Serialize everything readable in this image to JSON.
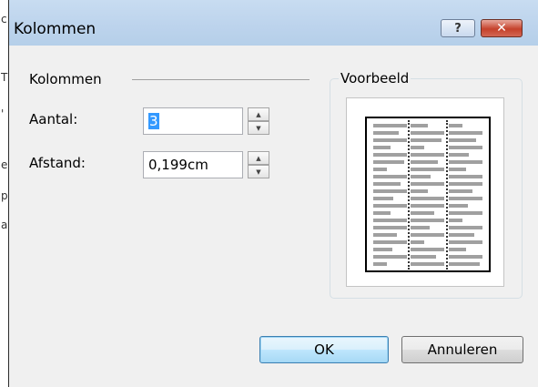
{
  "background_doc": {
    "fragments": [
      "c",
      "T",
      "'",
      "e",
      "p",
      "a"
    ]
  },
  "dialog": {
    "title": "Kolommen",
    "help_glyph": "?",
    "close_glyph": "✕",
    "section_label": "Kolommen",
    "count": {
      "label": "Aantal:",
      "value": "3"
    },
    "spacing": {
      "label": "Afstand:",
      "value": "0,199cm"
    },
    "preview": {
      "title": "Voorbeeld",
      "columns": 3
    },
    "ok_label": "OK",
    "cancel_label": "Annuleren"
  },
  "icons": [
    "help-icon",
    "close-icon",
    "spin-up-icon",
    "spin-down-icon"
  ]
}
